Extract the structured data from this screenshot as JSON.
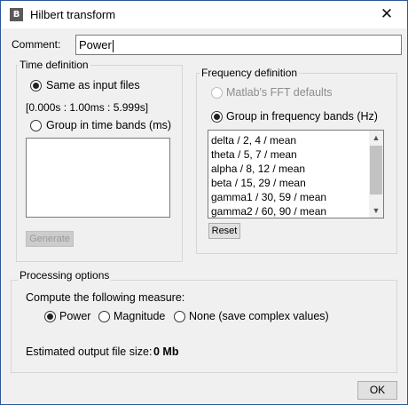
{
  "window": {
    "title": "Hilbert transform",
    "icon": "brainstorm-app-icon",
    "close_icon": "✕"
  },
  "comment": {
    "label": "Comment:",
    "value": "Power"
  },
  "time_definition": {
    "legend": "Time definition",
    "option_same": "Same as input files",
    "time_range": "[0.000s : 1.00ms : 5.999s]",
    "option_bands": "Group in time bands (ms)",
    "bands_text": "",
    "generate_label": "Generate"
  },
  "frequency_definition": {
    "legend": "Frequency definition",
    "option_fft": "Matlab's FFT defaults",
    "option_bands": "Group in frequency bands (Hz)",
    "bands": [
      "delta / 2, 4 / mean",
      "theta / 5, 7 / mean",
      "alpha / 8, 12 / mean",
      "beta / 15, 29 / mean",
      "gamma1 / 30, 59 / mean",
      "gamma2 / 60, 90 / mean"
    ],
    "reset_label": "Reset",
    "scroll_up": "▲",
    "scroll_down": "▼"
  },
  "processing": {
    "legend": "Processing options",
    "measure_label": "Compute the following measure:",
    "measure_options": [
      "Power",
      "Magnitude",
      "None (save complex values)"
    ],
    "selected_measure": "Power",
    "size_label": "Estimated output file size:",
    "size_value": "0 Mb"
  },
  "ok_label": "OK"
}
